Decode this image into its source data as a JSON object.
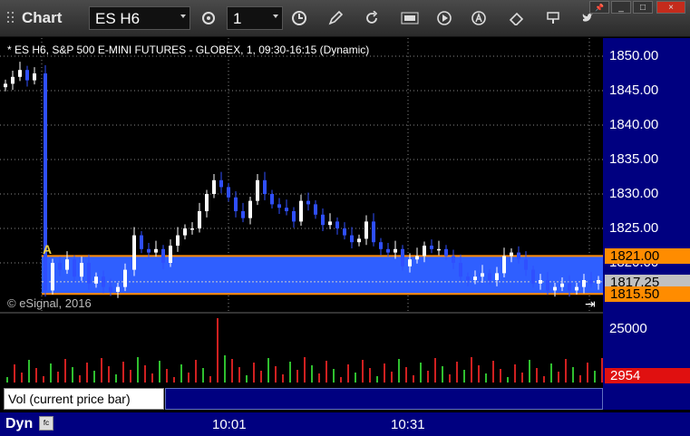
{
  "app": {
    "title": "Chart"
  },
  "toolbar": {
    "symbol": "ES H6",
    "interval": "1",
    "icons": [
      "gear-icon",
      "clock-icon",
      "pencil-icon",
      "refresh-icon",
      "GET",
      "play-icon",
      "A-icon",
      "eraser-icon",
      "paint-icon",
      "twitter-icon"
    ]
  },
  "window_controls": {
    "pin": "📌",
    "minimize": "_",
    "restore": "□",
    "close": "×"
  },
  "chart": {
    "title": "* ES H6, S&P 500 E-MINI FUTURES - GLOBEX, 1, 09:30-16:15 (Dynamic)",
    "copyright": "© eSignal, 2016",
    "marker_label": "A",
    "price_ticks": [
      "1850.00",
      "1845.00",
      "1840.00",
      "1835.00",
      "1830.00",
      "1825.00",
      "1820.00"
    ],
    "price_tags": [
      {
        "value": "1821.00",
        "color": "#ff8c00"
      },
      {
        "value": "1817.25",
        "color": "#c0c0c0"
      },
      {
        "value": "1815.50",
        "color": "#ff8c00"
      }
    ],
    "band_color": "#2f5fff",
    "up_color": "#ffffff",
    "down_color": "#2f4fff"
  },
  "volume": {
    "label": "Vol (current price bar)",
    "close": "×",
    "tick": "25000",
    "current": "2954",
    "current_color": "#e01010"
  },
  "time_axis": {
    "mode": "Dyn",
    "labels": [
      "10:01",
      "10:31"
    ]
  }
}
